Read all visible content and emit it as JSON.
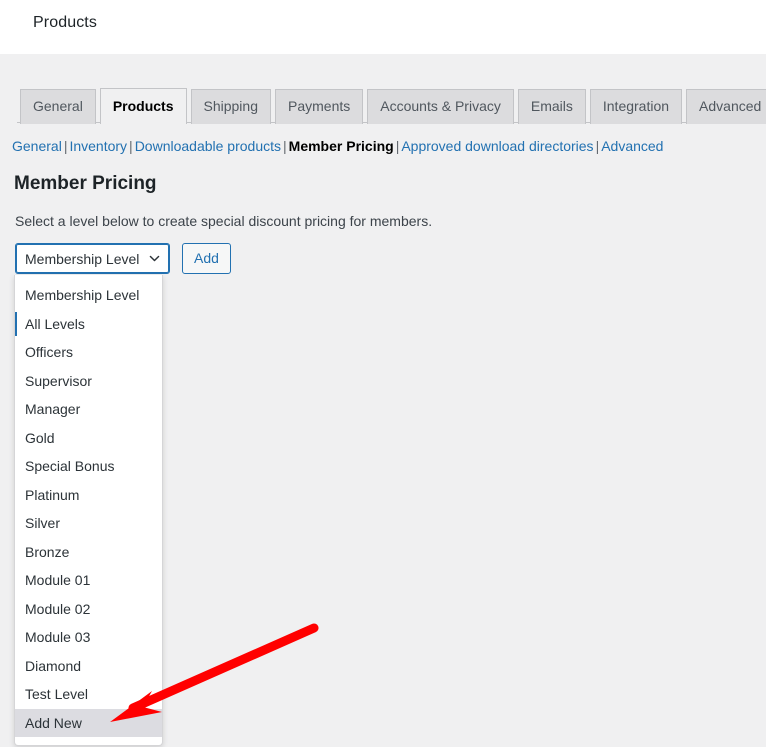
{
  "header": {
    "page_title": "Products"
  },
  "tabs": [
    {
      "label": "General",
      "active": false
    },
    {
      "label": "Products",
      "active": true
    },
    {
      "label": "Shipping",
      "active": false
    },
    {
      "label": "Payments",
      "active": false
    },
    {
      "label": "Accounts & Privacy",
      "active": false
    },
    {
      "label": "Emails",
      "active": false
    },
    {
      "label": "Integration",
      "active": false
    },
    {
      "label": "Advanced",
      "active": false
    }
  ],
  "subnav": {
    "separator": "|",
    "items": [
      {
        "label": "General",
        "current": false
      },
      {
        "label": "Inventory",
        "current": false
      },
      {
        "label": "Downloadable products",
        "current": false
      },
      {
        "label": "Member Pricing",
        "current": true
      },
      {
        "label": "Approved download directories",
        "current": false
      },
      {
        "label": "Advanced",
        "current": false
      }
    ]
  },
  "main": {
    "section_title": "Member Pricing",
    "section_description": "Select a level below to create special discount pricing for members.",
    "membership_select": {
      "value": "Membership Level",
      "chevron_icon": "chevron-down-icon",
      "options": [
        {
          "label": "Membership Level",
          "selected": false,
          "hovered": false
        },
        {
          "label": "All Levels",
          "selected": true,
          "hovered": false
        },
        {
          "label": "Officers",
          "selected": false,
          "hovered": false
        },
        {
          "label": "Supervisor",
          "selected": false,
          "hovered": false
        },
        {
          "label": "Manager",
          "selected": false,
          "hovered": false
        },
        {
          "label": "Gold",
          "selected": false,
          "hovered": false
        },
        {
          "label": "Special Bonus",
          "selected": false,
          "hovered": false
        },
        {
          "label": "Platinum",
          "selected": false,
          "hovered": false
        },
        {
          "label": "Silver",
          "selected": false,
          "hovered": false
        },
        {
          "label": "Bronze",
          "selected": false,
          "hovered": false
        },
        {
          "label": "Module 01",
          "selected": false,
          "hovered": false
        },
        {
          "label": "Module 02",
          "selected": false,
          "hovered": false
        },
        {
          "label": "Module 03",
          "selected": false,
          "hovered": false
        },
        {
          "label": "Diamond",
          "selected": false,
          "hovered": false
        },
        {
          "label": "Test Level",
          "selected": false,
          "hovered": false
        },
        {
          "label": "Add New",
          "selected": false,
          "hovered": true
        }
      ]
    },
    "add_button_label": "Add"
  },
  "annotation": {
    "arrow_color": "#ff0000",
    "points_at": "Add New"
  },
  "colors": {
    "accent_blue": "#2271b1",
    "link_blue": "#2271b1",
    "body_background": "#f0f0f1",
    "header_background": "#ffffff",
    "tab_inactive_background": "#dcdcde",
    "dropdown_hover_background": "#dcdce1",
    "annotation_red": "#ff0000"
  }
}
